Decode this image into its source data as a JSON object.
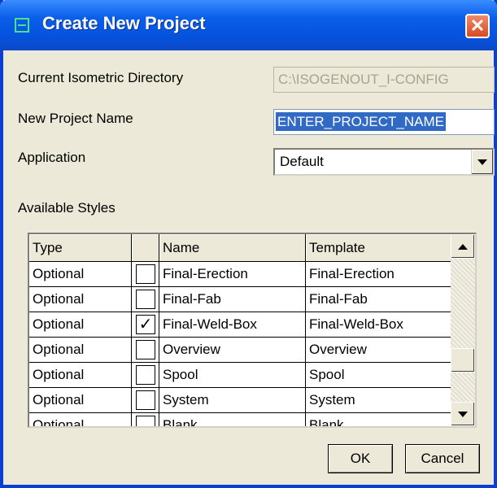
{
  "window": {
    "title": "Create New Project",
    "close_glyph": "✕"
  },
  "form": {
    "current_dir_label": "Current Isometric Directory",
    "current_dir_value": "C:\\ISOGENOUT_I-CONFIG",
    "project_name_label": "New Project Name",
    "project_name_value": "ENTER_PROJECT_NAME",
    "application_label": "Application",
    "application_value": "Default",
    "styles_label": "Available Styles"
  },
  "table": {
    "headers": [
      "Type",
      "",
      "Name",
      "Template"
    ],
    "rows": [
      {
        "type": "Optional",
        "checked": "",
        "name": "Final-Erection",
        "template": "Final-Erection"
      },
      {
        "type": "Optional",
        "checked": "",
        "name": "Final-Fab",
        "template": "Final-Fab"
      },
      {
        "type": "Optional",
        "checked": "✓",
        "name": "Final-Weld-Box",
        "template": "Final-Weld-Box"
      },
      {
        "type": "Optional",
        "checked": "",
        "name": "Overview",
        "template": "Overview"
      },
      {
        "type": "Optional",
        "checked": "",
        "name": "Spool",
        "template": "Spool"
      },
      {
        "type": "Optional",
        "checked": "",
        "name": "System",
        "template": "System"
      },
      {
        "type": "Optional",
        "checked": "",
        "name": "Blank",
        "template": "Blank"
      }
    ]
  },
  "buttons": {
    "ok": "OK",
    "cancel": "Cancel"
  },
  "colors": {
    "title_bar": "#0553df",
    "selection": "#316ac5",
    "face": "#ece9d8"
  }
}
